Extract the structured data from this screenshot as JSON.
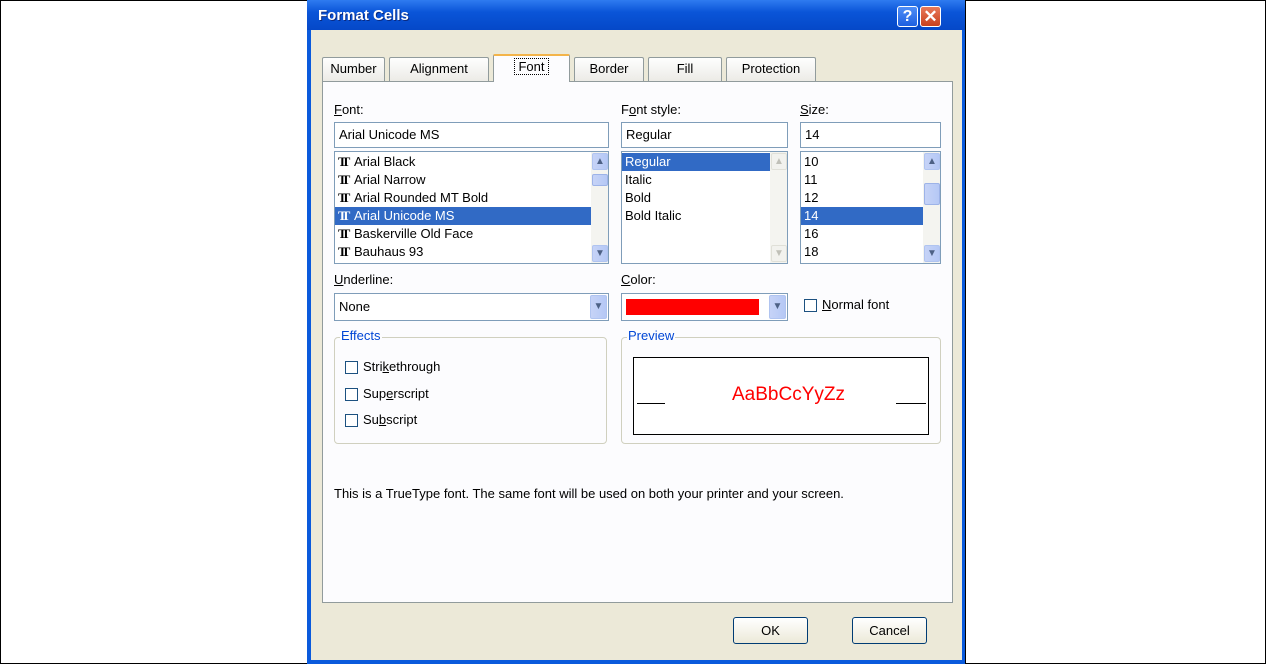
{
  "window": {
    "title": "Format Cells",
    "help_glyph": "?",
    "close_glyph": "✕"
  },
  "tabs": [
    {
      "label": "Number"
    },
    {
      "label": "Alignment"
    },
    {
      "label": "Font",
      "active": true
    },
    {
      "label": "Border"
    },
    {
      "label": "Fill"
    },
    {
      "label": "Protection"
    }
  ],
  "font": {
    "label": "Font:",
    "value": "Arial Unicode MS",
    "items": [
      "Arial Black",
      "Arial Narrow",
      "Arial Rounded MT Bold",
      "Arial Unicode MS",
      "Baskerville Old Face",
      "Bauhaus 93"
    ],
    "selected": "Arial Unicode MS",
    "icon": "truetype-icon",
    "icon_glyph": "TT"
  },
  "font_style": {
    "label": "Font style:",
    "value": "Regular",
    "items": [
      "Regular",
      "Italic",
      "Bold",
      "Bold Italic"
    ],
    "selected": "Regular"
  },
  "size": {
    "label": "Size:",
    "value": "14",
    "items": [
      "10",
      "11",
      "12",
      "14",
      "16",
      "18"
    ],
    "selected": "14"
  },
  "underline": {
    "label": "Underline:",
    "value": "None"
  },
  "color": {
    "label": "Color:",
    "swatch": "#ff0000"
  },
  "normal_font": {
    "label": "Normal font",
    "checked": false
  },
  "effects": {
    "title": "Effects",
    "items": [
      {
        "label": "Strikethrough",
        "checked": false
      },
      {
        "label": "Superscript",
        "checked": false
      },
      {
        "label": "Subscript",
        "checked": false
      }
    ]
  },
  "preview": {
    "title": "Preview",
    "sample": "AaBbCcYyZz",
    "color": "#ff0000"
  },
  "description": "This is a TrueType font.  The same font will be used on both your printer and your screen.",
  "buttons": {
    "ok": "OK",
    "cancel": "Cancel"
  },
  "colors": {
    "titlebar": "#0a55d8",
    "selection": "#316ac5",
    "group_title": "#0046d5",
    "dialog_bg": "#ece9d8"
  }
}
